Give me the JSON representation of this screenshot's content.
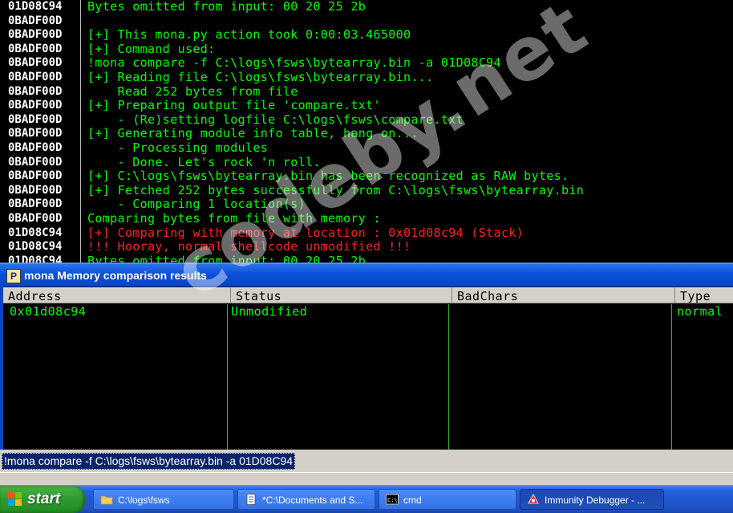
{
  "log": {
    "lines": [
      {
        "addr": "01D08C94",
        "msg": "Bytes omitted from input: 00 20 25 2b",
        "color": "green"
      },
      {
        "addr": "0BADF00D",
        "msg": "",
        "color": "green"
      },
      {
        "addr": "0BADF00D",
        "msg": "[+] This mona.py action took 0:00:03.465000",
        "color": "green"
      },
      {
        "addr": "0BADF00D",
        "msg": "[+] Command used:",
        "color": "green"
      },
      {
        "addr": "0BADF00D",
        "msg": "!mona compare -f C:\\logs\\fsws\\bytearray.bin -a 01D08C94",
        "color": "green"
      },
      {
        "addr": "0BADF00D",
        "msg": "[+] Reading file C:\\logs\\fsws\\bytearray.bin...",
        "color": "green"
      },
      {
        "addr": "0BADF00D",
        "msg": "    Read 252 bytes from file",
        "color": "green"
      },
      {
        "addr": "0BADF00D",
        "msg": "[+] Preparing output file 'compare.txt'",
        "color": "green"
      },
      {
        "addr": "0BADF00D",
        "msg": "    - (Re)setting logfile C:\\logs\\fsws\\compare.txt",
        "color": "green"
      },
      {
        "addr": "0BADF00D",
        "msg": "[+] Generating module info table, hang on...",
        "color": "green"
      },
      {
        "addr": "0BADF00D",
        "msg": "    - Processing modules",
        "color": "green"
      },
      {
        "addr": "0BADF00D",
        "msg": "    - Done. Let's rock 'n roll.",
        "color": "green"
      },
      {
        "addr": "0BADF00D",
        "msg": "[+] C:\\logs\\fsws\\bytearray.bin has been recognized as RAW bytes.",
        "color": "green"
      },
      {
        "addr": "0BADF00D",
        "msg": "[+] Fetched 252 bytes successfully from C:\\logs\\fsws\\bytearray.bin",
        "color": "green"
      },
      {
        "addr": "0BADF00D",
        "msg": "    - Comparing 1 location(s)",
        "color": "green"
      },
      {
        "addr": "0BADF00D",
        "msg": "Comparing bytes from file with memory :",
        "color": "green"
      },
      {
        "addr": "01D08C94",
        "msg": "[+] Comparing with memory at location : 0x01d08c94 (Stack)",
        "color": "red"
      },
      {
        "addr": "01D08C94",
        "msg": "!!! Hooray, normal shellcode unmodified !!!",
        "color": "red"
      },
      {
        "addr": "01D08C94",
        "msg": "Bytes omitted from input: 00 20 25 2b",
        "color": "green"
      }
    ]
  },
  "results_window": {
    "icon_letter": "P",
    "title": "mona Memory comparison results",
    "columns": [
      "Address",
      "Status",
      "BadChars",
      "Type"
    ],
    "rows": [
      [
        "0x01d08c94",
        "Unmodified",
        "",
        "normal"
      ]
    ]
  },
  "command_bar": {
    "value": "!mona compare -f C:\\logs\\fsws\\bytearray.bin -a 01D08C94"
  },
  "taskbar": {
    "start_label": "start",
    "tasks": [
      {
        "label": "C:\\logs\\fsws",
        "icon": "folder-icon"
      },
      {
        "label": "*C:\\Documents and S...",
        "icon": "notepad-icon"
      },
      {
        "label": "cmd",
        "icon": "cmd-icon"
      },
      {
        "label": "Immunity Debugger - ...",
        "icon": "immunity-icon"
      }
    ]
  },
  "watermark": "codeby.net",
  "colors": {
    "log_green": "#00ff00",
    "log_red": "#ff2020",
    "title_blue": "#0a50d8",
    "taskbar_blue": "#245edb",
    "start_green": "#2e9a2e"
  }
}
